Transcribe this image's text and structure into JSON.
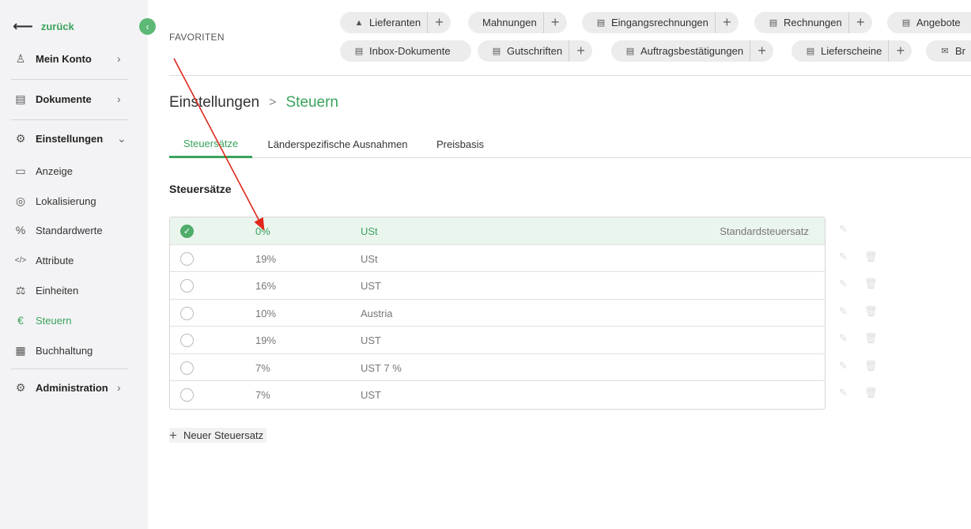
{
  "sidebar": {
    "back_label": "zurück",
    "collapse_icon": "‹",
    "items": [
      {
        "label": "Mein Konto",
        "icon": "user-icon",
        "glyph": "♙"
      },
      {
        "label": "Dokumente",
        "icon": "document-icon",
        "glyph": "▤"
      },
      {
        "label": "Einstellungen",
        "icon": "settings-icon",
        "glyph": "⚙"
      },
      {
        "label": "Anzeige",
        "icon": "monitor-icon",
        "glyph": "▭"
      },
      {
        "label": "Lokalisierung",
        "icon": "globe-icon",
        "glyph": "◎"
      },
      {
        "label": "Standardwerte",
        "icon": "percent-icon",
        "glyph": "%"
      },
      {
        "label": "Attribute",
        "icon": "code-icon",
        "glyph": "</>"
      },
      {
        "label": "Einheiten",
        "icon": "scale-icon",
        "glyph": "⚖"
      },
      {
        "label": "Steuern",
        "icon": "tax-bag-icon",
        "glyph": "€"
      },
      {
        "label": "Buchhaltung",
        "icon": "ledger-icon",
        "glyph": "▦"
      },
      {
        "label": "Administration",
        "icon": "admin-gear-icon",
        "glyph": "⚙"
      }
    ]
  },
  "favorites": {
    "label": "FAVORITEN",
    "pills": [
      {
        "label": "Lieferanten",
        "icon": "supplier-icon",
        "glyph": "▲"
      },
      {
        "label": "Mahnungen",
        "icon": "reminder-icon",
        "glyph": ""
      },
      {
        "label": "Eingangsrechnungen",
        "icon": "incoming-invoice-icon",
        "glyph": "▤"
      },
      {
        "label": "Rechnungen",
        "icon": "invoice-icon",
        "glyph": "▤"
      },
      {
        "label": "Angebote",
        "icon": "offer-icon",
        "glyph": "▤"
      },
      {
        "label": "Inbox-Dokumente",
        "icon": "inbox-icon",
        "glyph": "▤"
      },
      {
        "label": "Gutschriften",
        "icon": "credit-note-icon",
        "glyph": "▤"
      },
      {
        "label": "Auftragsbestätigungen",
        "icon": "order-confirmation-icon",
        "glyph": "▤"
      },
      {
        "label": "Lieferscheine",
        "icon": "delivery-note-icon",
        "glyph": "▤"
      },
      {
        "label": "Br",
        "icon": "mail-icon",
        "glyph": "✉"
      }
    ]
  },
  "breadcrumb": {
    "parent": "Einstellungen",
    "separator": ">",
    "current": "Steuern"
  },
  "tabs": [
    "Steuersätze",
    "Länderspezifische Ausnahmen",
    "Preisbasis"
  ],
  "section_title": "Steuersätze",
  "tax_rates": [
    {
      "rate": "0%",
      "name": "USt",
      "default_label": "Standardsteuersatz",
      "selected": true
    },
    {
      "rate": "19%",
      "name": "USt",
      "default_label": "",
      "selected": false
    },
    {
      "rate": "16%",
      "name": "UST",
      "default_label": "",
      "selected": false
    },
    {
      "rate": "10%",
      "name": "Austria",
      "default_label": "",
      "selected": false
    },
    {
      "rate": "19%",
      "name": "UST",
      "default_label": "",
      "selected": false
    },
    {
      "rate": "7%",
      "name": "UST 7 %",
      "default_label": "",
      "selected": false
    },
    {
      "rate": "7%",
      "name": "UST",
      "default_label": "",
      "selected": false
    }
  ],
  "new_rate_label": "Neuer Steuersatz",
  "colors": {
    "accent": "#3aa35c",
    "annotation_arrow": "#e0261b"
  }
}
